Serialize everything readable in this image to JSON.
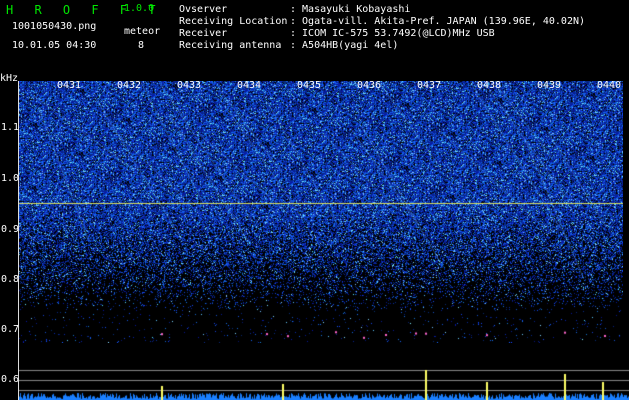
{
  "header": {
    "app_name": "H R O F F T",
    "app_version": "1.0.0",
    "file_name": "1001050430.png",
    "datetime": "10.01.05 04:30",
    "meteor_label": "meteor",
    "meteor_count": "8"
  },
  "info": [
    {
      "key": "Ovserver",
      "value": ": Masayuki Kobayashi"
    },
    {
      "key": "Receiving Location",
      "value": ": Ogata-vill. Akita-Pref. JAPAN (139.96E, 40.02N)"
    },
    {
      "key": "Receiver",
      "value": ": ICOM IC-575 53.7492(@LCD)MHz USB"
    },
    {
      "key": "Receiving antenna",
      "value": ": A504HB(yagi 4el)"
    }
  ],
  "axis": {
    "unit": "kHz",
    "freq_labels": [
      "1.1",
      "1.0",
      "0.9",
      "0.8",
      "0.7",
      "0.6"
    ],
    "time_labels": [
      "0431",
      "0432",
      "0433",
      "0434",
      "0435",
      "0436",
      "0437",
      "0438",
      "0439",
      "0440"
    ]
  },
  "colors": {
    "app_green": "#00e600",
    "reference_line": "#d8e060",
    "noise_dark": "#0a1a8c",
    "noise_light": "#3fa0ff",
    "meteor_echo": "#ffff66"
  }
}
